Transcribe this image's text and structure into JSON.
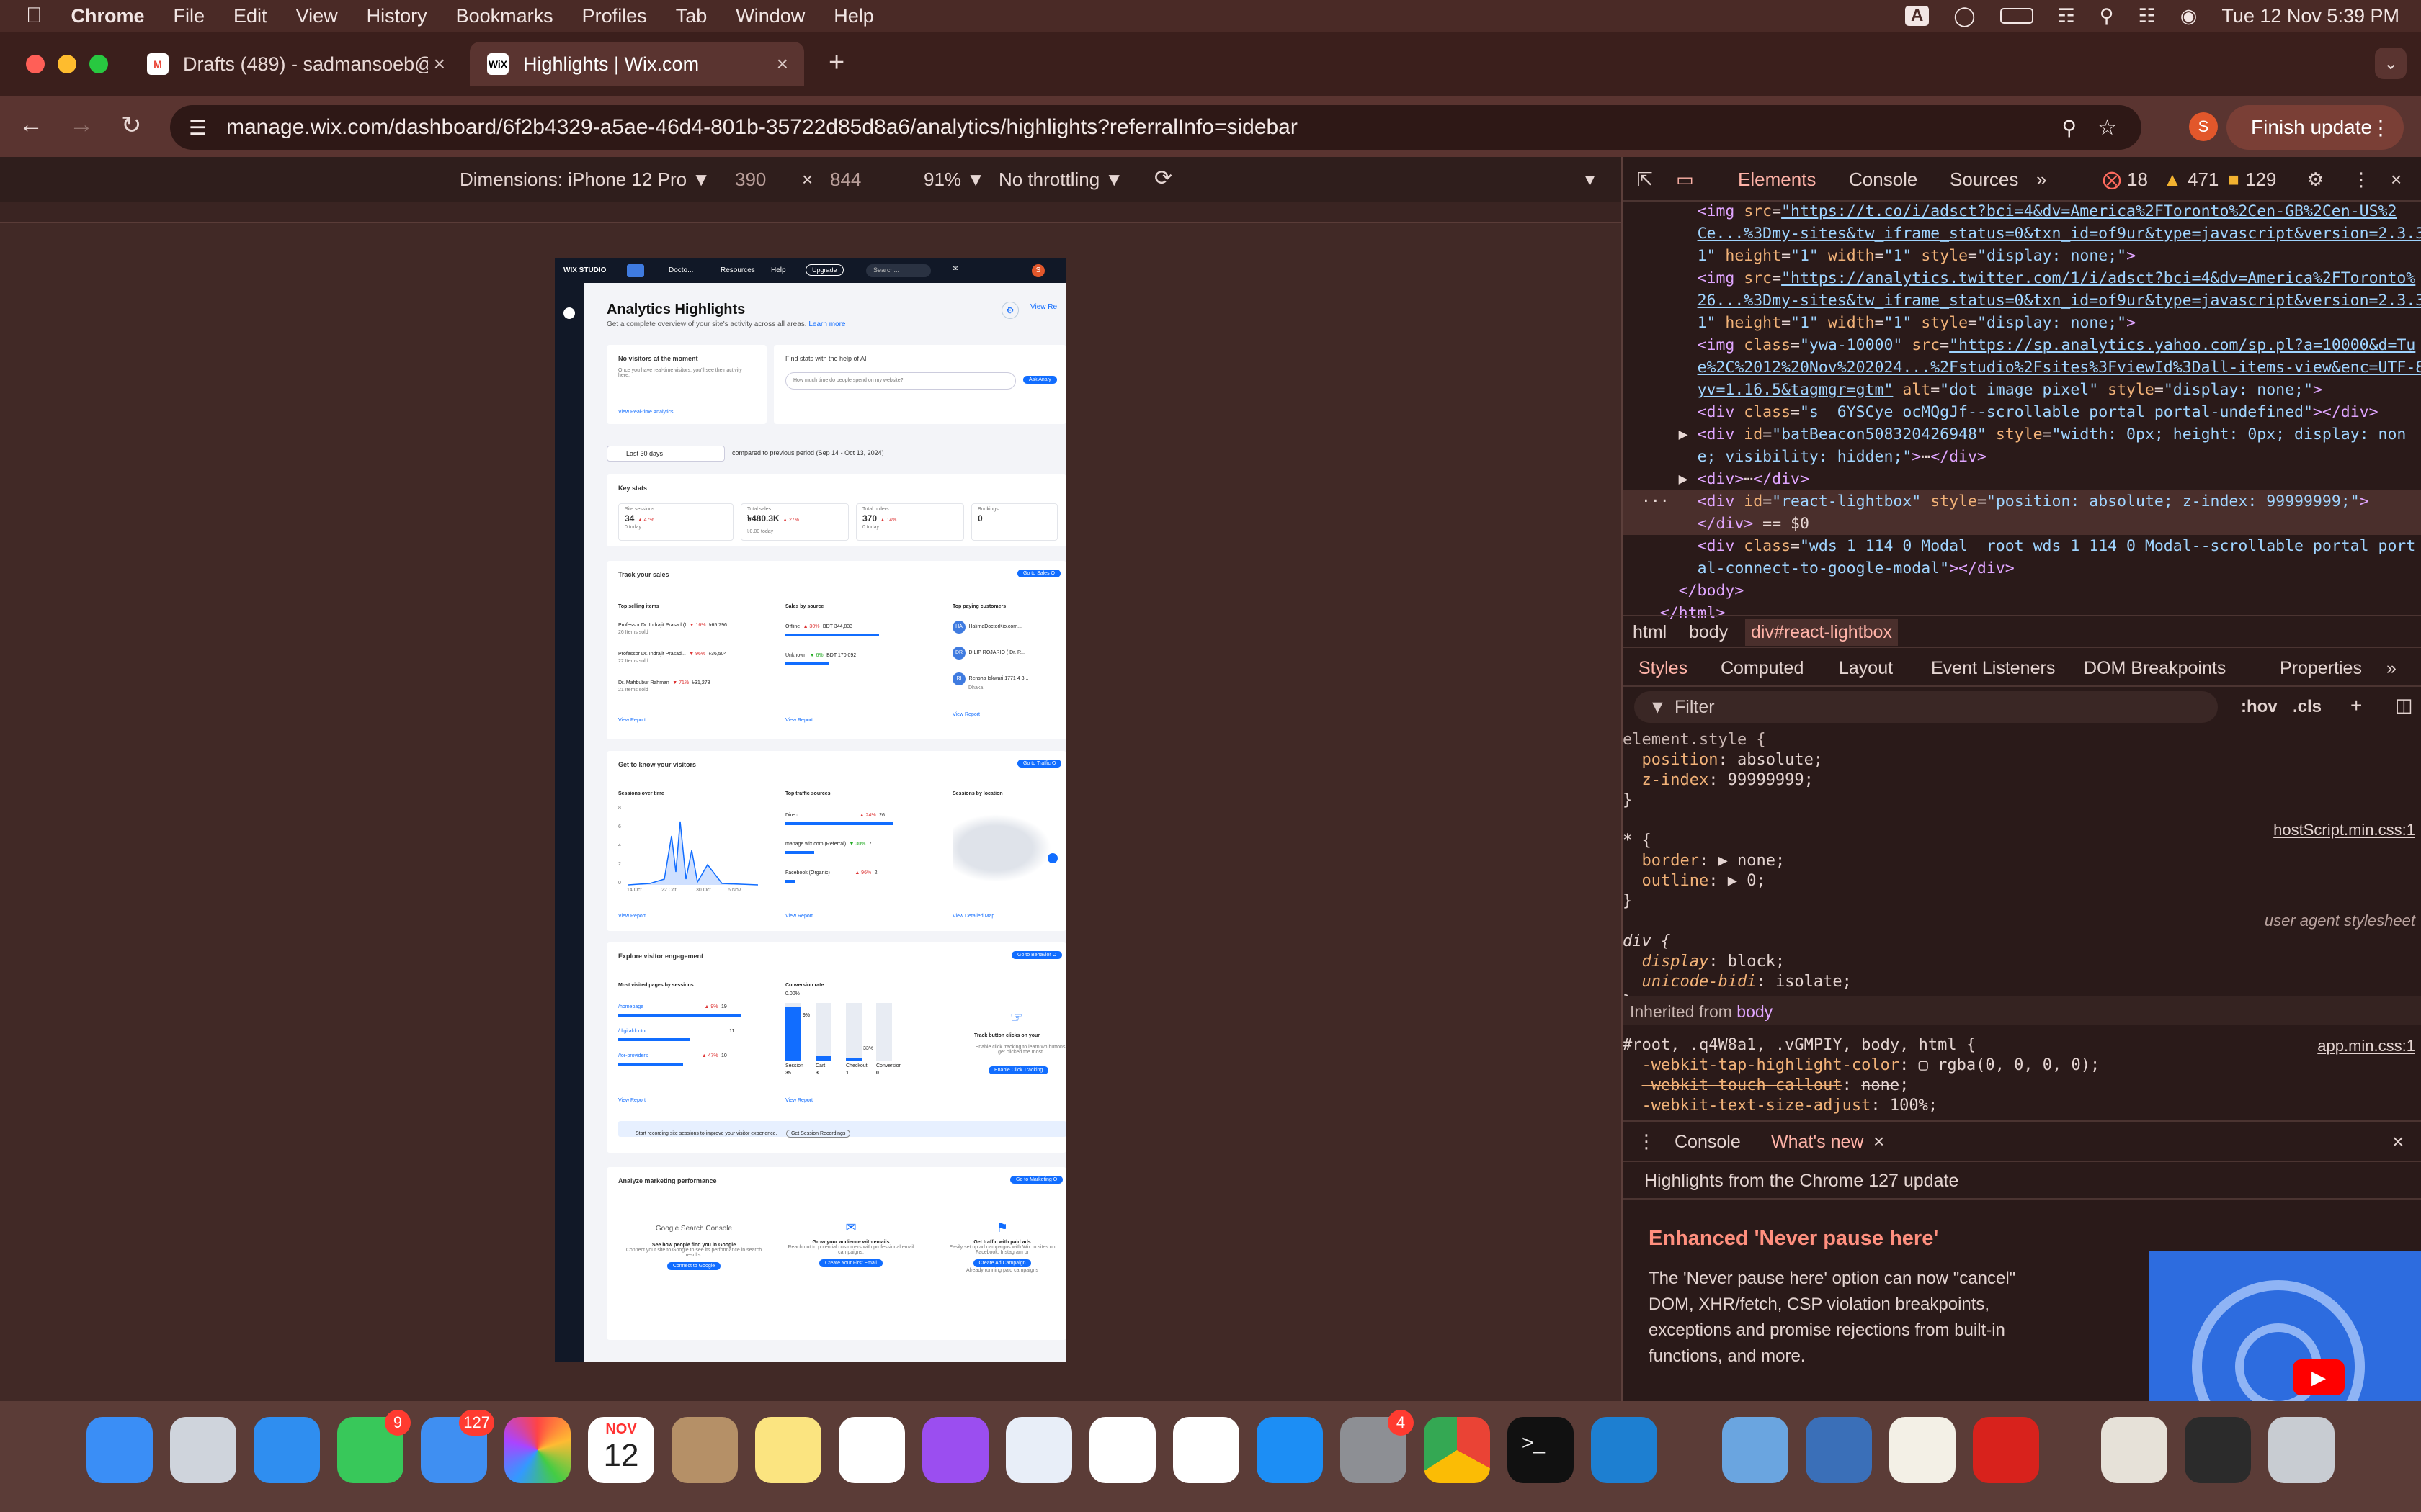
{
  "menubar": {
    "app": "Chrome",
    "items": [
      "File",
      "Edit",
      "View",
      "History",
      "Bookmarks",
      "Profiles",
      "Tab",
      "Window",
      "Help"
    ],
    "clock": "Tue 12 Nov  5:39 PM",
    "input_source": "A"
  },
  "tabs": [
    {
      "title": "Drafts (489) - sadmansoeb@",
      "favicon": "gmail-icon"
    },
    {
      "title": "Highlights | Wix.com",
      "favicon": "wix-icon"
    }
  ],
  "address": {
    "url": "manage.wix.com/dashboard/6f2b4329-a5ae-46d4-801b-35722d85d8a6/analytics/highlights?referralInfo=sidebar"
  },
  "profile_initial": "S",
  "finish_update_label": "Finish update",
  "device_toolbar": {
    "dimensions": "Dimensions: iPhone 12 Pro ▼",
    "width": "390",
    "times": "×",
    "height": "844",
    "zoom": "91% ▼",
    "throttle": "No throttling ▼"
  },
  "wix": {
    "logo": "WIX STUDIO",
    "site": "Docto...",
    "resources": "Resources",
    "help": "Help",
    "upgrade": "Upgrade",
    "search": "Search...",
    "avatar": "S",
    "title": "Analytics Highlights",
    "subtitle": "Get a complete overview of your site's activity across all areas.",
    "learn_more": "Learn more",
    "view_reports": "View Re",
    "no_visitors": "No visitors at the moment",
    "no_visitors_sub": "Once you have real-time visitors, you'll see their activity here.",
    "view_realtime": "View Real-time Analytics",
    "ai_title": "Find stats with the help of AI",
    "ai_placeholder": "How much time do people spend on my website?",
    "ai_button": "Ask Analy",
    "date_range": "Last 30 days",
    "compared": "compared to previous period (Sep 14 - Oct 13, 2024)",
    "key_stats_title": "Key stats",
    "key_stats": [
      {
        "label": "Site sessions",
        "value": "34",
        "change": "▲ 47%",
        "sub": "0 today"
      },
      {
        "label": "Total sales",
        "value": "৳480.3K",
        "change": "▲ 27%",
        "sub": "৳0.00 today"
      },
      {
        "label": "Total orders",
        "value": "370",
        "change": "▲ 14%",
        "sub": "0 today"
      },
      {
        "label": "Bookings",
        "value": "0",
        "change": "",
        "sub": ""
      }
    ],
    "sales_title": "Track your sales",
    "sales_button": "Go to Sales O",
    "top_selling_title": "Top selling items",
    "top_selling": [
      {
        "name": "Professor Dr. Indrajit Prasad (I",
        "change": "▼ 16%",
        "value": "৳65,796",
        "sub": "26 Items sold"
      },
      {
        "name": "Professor Dr. Indrajit Prasad...",
        "change": "▼ 96%",
        "value": "৳36,504",
        "sub": "22 Items sold"
      },
      {
        "name": "Dr. Mahbubur Rahman",
        "change": "▼ 71%",
        "value": "৳31,278",
        "sub": "21 Items sold"
      }
    ],
    "sales_source_title": "Sales by source",
    "sales_source": [
      {
        "name": "Offline",
        "change": "▲ 30%",
        "value": "BDT 344,833"
      },
      {
        "name": "Unknown",
        "change": "▼ 6%",
        "value": "BDT 170,092"
      }
    ],
    "paying_title": "Top paying customers",
    "paying": [
      {
        "initials": "HA",
        "name": "HalimaDoctorKio.com..."
      },
      {
        "initials": "DR",
        "name": "DILIP ROJARIO ( Dr. R..."
      },
      {
        "initials": "RI",
        "name": "Rensha Iskwari 1771 4 3...",
        "sub": "Dhaka"
      }
    ],
    "view_report": "View Report",
    "visitors_title": "Get to know your visitors",
    "visitors_button": "Go to Traffic O",
    "sessions_title": "Sessions over time",
    "sessions_y": [
      "8",
      "6",
      "4",
      "2",
      "0"
    ],
    "sessions_x": [
      "14 Oct",
      "22 Oct",
      "30 Oct",
      "6 Nov"
    ],
    "traffic_title": "Top traffic sources",
    "traffic": [
      {
        "name": "Direct",
        "change": "▲ 24%",
        "value": "26"
      },
      {
        "name": "manage.wix.com (Referral)",
        "change": "▼ 30%",
        "value": "7"
      },
      {
        "name": "Facebook (Organic)",
        "change": "▲ 96%",
        "value": "2"
      }
    ],
    "location_title": "Sessions by location",
    "view_map": "View Detailed Map",
    "engagement_title": "Explore visitor engagement",
    "engagement_button": "Go to Behavior O",
    "pages_title": "Most visited pages by sessions",
    "pages": [
      {
        "name": "/homepage",
        "change": "▲ 9%",
        "value": "19"
      },
      {
        "name": "/digitaldoctor",
        "change": "",
        "value": "11"
      },
      {
        "name": "/for-providers",
        "change": "▲ 47%",
        "value": "10"
      }
    ],
    "conversion_title": "Conversion rate",
    "conversion_value": "0.00%",
    "conversion_bars": [
      {
        "label": "Session",
        "count": "35",
        "pct": "9%",
        "level": 0.92
      },
      {
        "label": "Cart",
        "count": "3",
        "pct": "",
        "level": 0.09
      },
      {
        "label": "Checkout",
        "count": "1",
        "pct": "33%",
        "level": 0.04
      },
      {
        "label": "Conversion",
        "count": "0",
        "pct": "",
        "level": 0
      }
    ],
    "track_title": "Track button clicks on your",
    "track_sub": "Enable click tracking to learn wh buttons get clicked the most",
    "track_button": "Enable Click Tracking",
    "recording_text": "Start recording site sessions to improve your visitor experience.",
    "recording_button": "Get Session Recordings",
    "marketing_title": "Analyze marketing performance",
    "marketing_button": "Go to Marketing O",
    "marketing": [
      {
        "logo": "Google Search Console",
        "title": "See how people find you in Google",
        "sub": "Connect your site to Google to see its performance in search results.",
        "button": "Connect to Google"
      },
      {
        "logo": "",
        "title": "Grow your audience with emails",
        "sub": "Reach out to potential customers with professional email campaigns.",
        "button": "Create Your First Email"
      },
      {
        "logo": "",
        "title": "Get traffic with paid ads",
        "sub": "Easily set up ad campaigns with Wix to sites on Facebook, Instagram or",
        "button": "Create Ad Campaign",
        "extra": "Already running paid campaigns"
      }
    ]
  },
  "devtools": {
    "tabs": [
      "Elements",
      "Console",
      "Sources"
    ],
    "errors": "18",
    "warnings": "471",
    "info": "129",
    "breadcrumbs": [
      "html",
      "body",
      "div#react-lightbox"
    ],
    "subtabs": [
      "Styles",
      "Computed",
      "Layout",
      "Event Listeners",
      "DOM Breakpoints",
      "Properties"
    ],
    "filter_placeholder": "Filter",
    "hov": ":hov",
    "cls": ".cls",
    "source1": "hostScript.min.css:1",
    "source2": "user agent stylesheet",
    "source3": "app.min.css:1",
    "inherited": "Inherited from",
    "inherited_el": "body",
    "drawer_tabs": [
      "Console",
      "What's new"
    ],
    "whats_new_header": "Highlights from the Chrome 127 update",
    "feature_title": "Enhanced 'Never pause here'",
    "feature_body": "The 'Never pause here' option can now \"cancel\" DOM, XHR/fetch, CSP violation breakpoints, exceptions and promise rejections from built-in functions, and more."
  },
  "dock": {
    "messages_badge": "9",
    "mail_badge": "127",
    "calendar_month": "NOV",
    "calendar_day": "12",
    "settings_badge": "4"
  }
}
